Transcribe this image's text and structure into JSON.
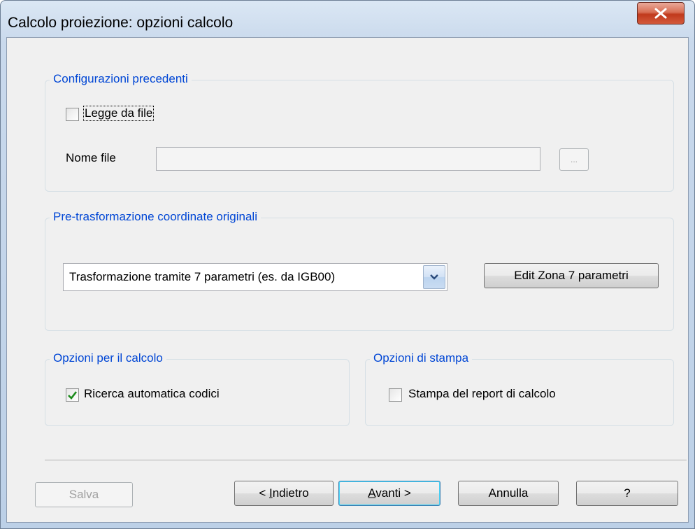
{
  "window": {
    "title": "Calcolo proiezione: opzioni calcolo"
  },
  "group_previous": {
    "legend": "Configurazioni precedenti",
    "read_from_file": {
      "label": "Legge da file",
      "checked": false
    },
    "file_name_label": "Nome file",
    "file_name_value": "",
    "browse_label": "..."
  },
  "group_pretransform": {
    "legend": "Pre-trasformazione coordinate originali",
    "selected_option": "Trasformazione tramite 7 parametri (es. da IGB00)",
    "edit_zone_label": "Edit Zona 7 parametri"
  },
  "group_calc_options": {
    "legend": "Opzioni per il calcolo",
    "auto_search": {
      "label": "Ricerca automatica codici",
      "checked": true
    }
  },
  "group_print_options": {
    "legend": "Opzioni di stampa",
    "print_report": {
      "label": "Stampa del report di calcolo",
      "checked": false
    }
  },
  "buttons": {
    "save": "Salva",
    "back_prefix": "< ",
    "back_mnemonic": "I",
    "back_rest": "ndietro",
    "next_mnemonic": "A",
    "next_rest": "vanti >",
    "cancel": "Annulla",
    "help": "?"
  },
  "colors": {
    "legend_text": "#0046d5",
    "close_button": "#c0391c",
    "check_mark": "#1a8a1a"
  }
}
